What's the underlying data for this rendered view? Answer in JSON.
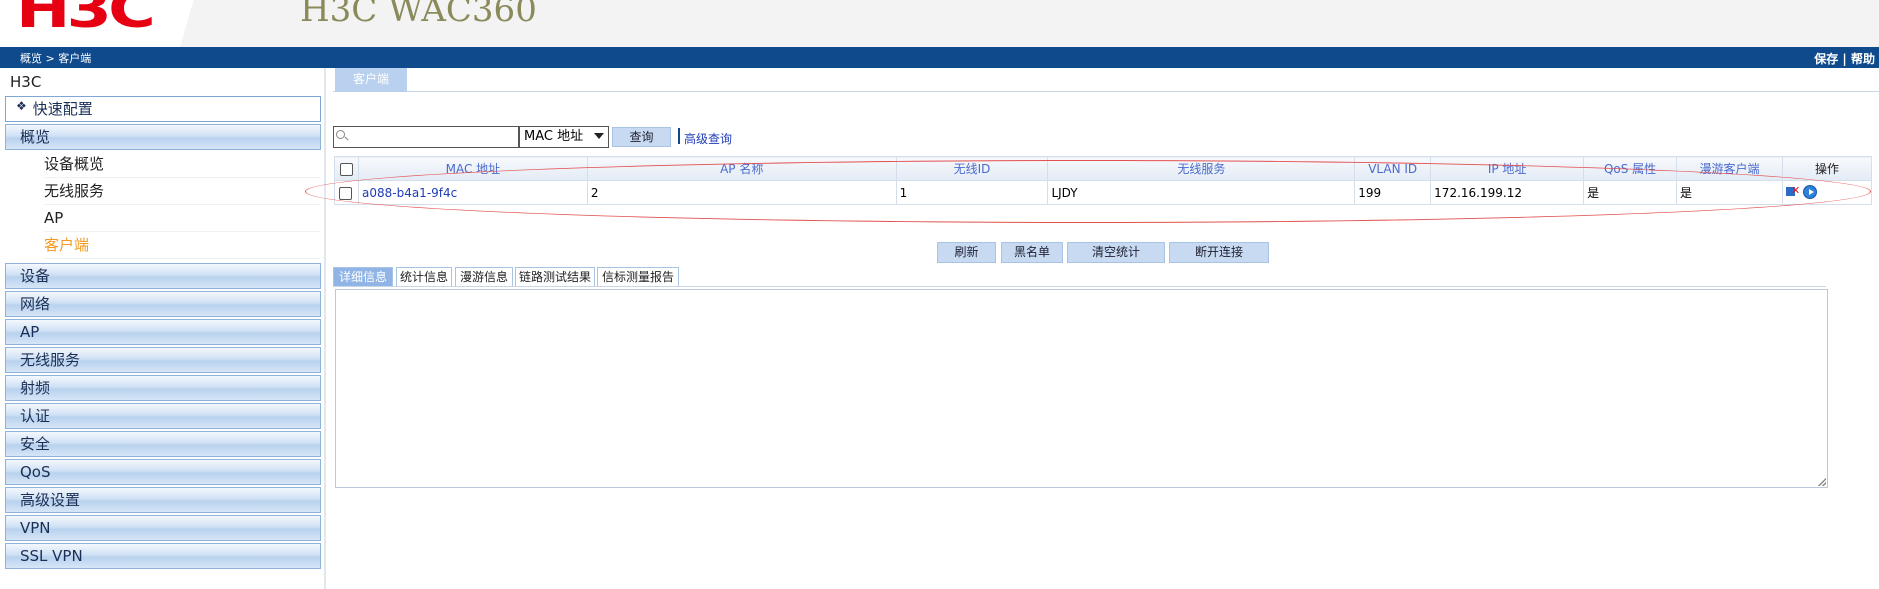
{
  "header": {
    "logo": "H3C",
    "product": "H3C WAC360",
    "breadcrumb": [
      "概览",
      "客户端"
    ],
    "breadcrumb_sep": ">",
    "links": [
      "保存",
      "帮助"
    ],
    "links_sep": "|"
  },
  "sidebar": {
    "root": "H3C",
    "quick": "快速配置",
    "overview": "概览",
    "sub_items": [
      "设备概览",
      "无线服务",
      "AP",
      "客户端"
    ],
    "active_sub": "客户端",
    "sections": [
      "设备",
      "网络",
      "AP",
      "无线服务",
      "射频",
      "认证",
      "安全",
      "QoS",
      "高级设置",
      "VPN",
      "SSL VPN"
    ]
  },
  "main": {
    "top_tab": "客户端",
    "search": {
      "value": "",
      "select_value": "MAC 地址",
      "query_button": "查询",
      "advanced_link": "高级查询"
    },
    "table": {
      "columns": [
        "MAC 地址",
        "AP 名称",
        "无线ID",
        "无线服务",
        "VLAN ID",
        "IP 地址",
        "QoS 属性",
        "漫游客户端",
        "操作"
      ],
      "rows": [
        {
          "mac": "a088-b4a1-9f4c",
          "ap_name": "2",
          "radio_id": "1",
          "service": "LJDY",
          "vlan": "199",
          "ip": "172.16.199.12",
          "qos": "是",
          "roaming": "是"
        }
      ]
    },
    "buttons": [
      "刷新",
      "黑名单",
      "清空统计",
      "断开连接"
    ],
    "detail_tabs": [
      "详细信息",
      "统计信息",
      "漫游信息",
      "链路测试结果",
      "信标测量报告"
    ],
    "active_detail_tab": "详细信息"
  },
  "colors": {
    "brand_red": "#e60012",
    "top_bar": "#0f4b8c",
    "active_menu": "#f39a1e",
    "link": "#1f3cb8",
    "highlight_ellipse": "#e35050"
  }
}
